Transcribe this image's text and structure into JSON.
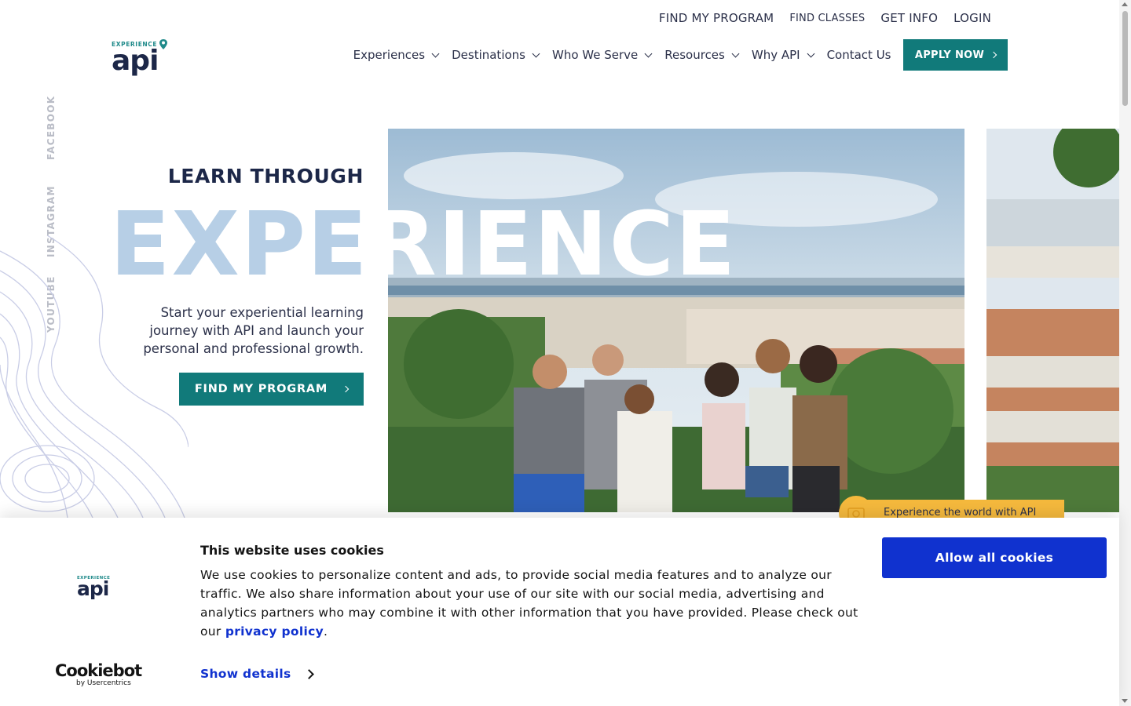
{
  "utility_nav": [
    "FIND MY PROGRAM",
    "FIND CLASSES",
    "GET INFO",
    "LOGIN"
  ],
  "logo": {
    "small": "EXPERIENCE",
    "big": "api"
  },
  "main_nav": {
    "items": [
      "Experiences",
      "Destinations",
      "Who We Serve",
      "Resources",
      "Why API",
      "Contact Us"
    ],
    "apply_label": "APPLY NOW"
  },
  "social": [
    "FACEBOOK",
    "INSTAGRAM",
    "YOUTUBE"
  ],
  "hero": {
    "title": "LEARN THROUGH",
    "big_word_left": "EXPE",
    "big_word_right": "RIENCE",
    "text": "Start your experiential learning journey with API and launch your personal and professional growth.",
    "cta": "FIND MY PROGRAM",
    "tag": "Experience the world with API"
  },
  "cookie": {
    "title": "This website uses cookies",
    "body_before": "We use cookies to personalize content and ads, to provide social media features and to analyze our traffic. We also share information about your use of our site with our social media, advertising and analytics partners who may combine it with other information that you have provided. Please check out our ",
    "link": "privacy policy",
    "body_after": ".",
    "details": "Show details",
    "allow": "Allow all cookies",
    "brand": "Cookiebot",
    "brand_sub": "by Usercentrics"
  },
  "colors": {
    "teal": "#117a7a",
    "navy": "#1c2748",
    "cookie_blue": "#1032cf",
    "tag_yellow": "#f5b93d"
  }
}
